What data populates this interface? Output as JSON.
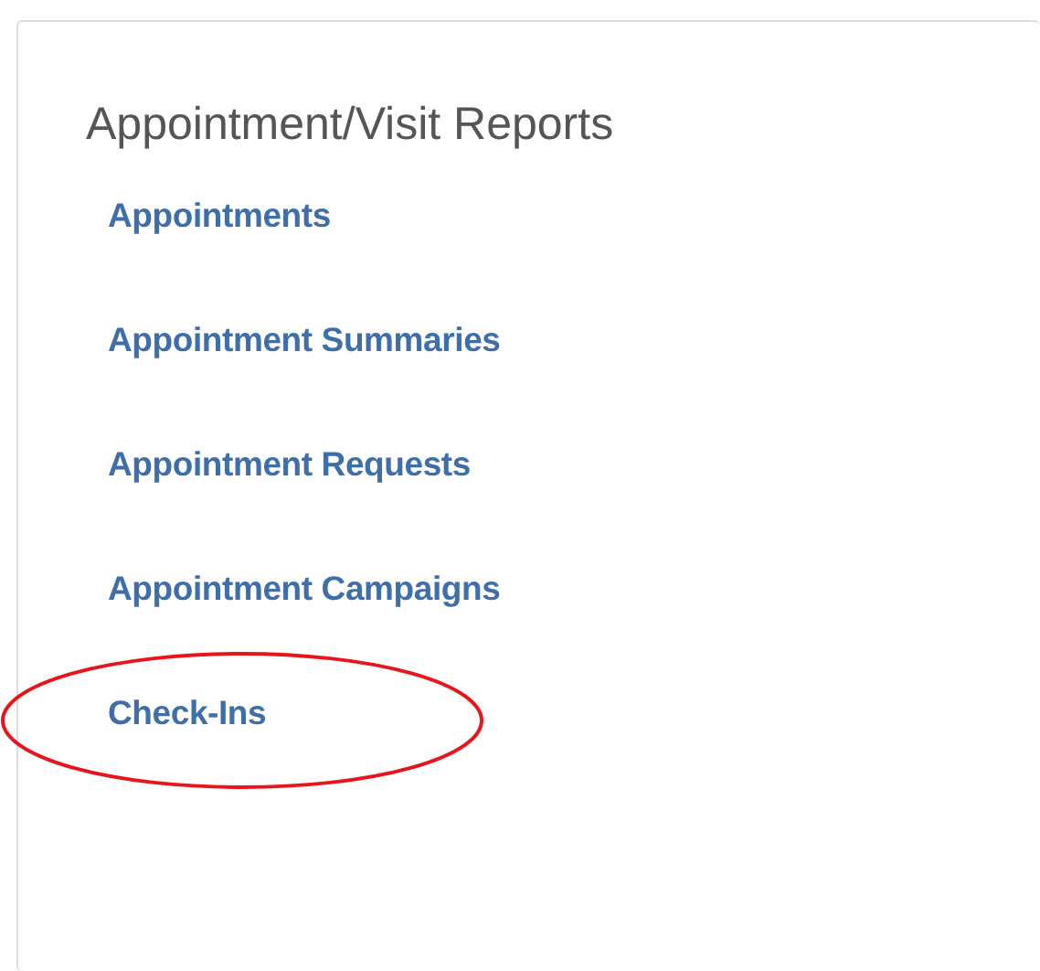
{
  "panel": {
    "title": "Appointment/Visit Reports",
    "links": [
      {
        "label": "Appointments",
        "circled": false
      },
      {
        "label": "Appointment Summaries",
        "circled": false
      },
      {
        "label": "Appointment Requests",
        "circled": false
      },
      {
        "label": "Appointment Campaigns",
        "circled": false
      },
      {
        "label": "Check-Ins",
        "circled": true
      }
    ]
  }
}
